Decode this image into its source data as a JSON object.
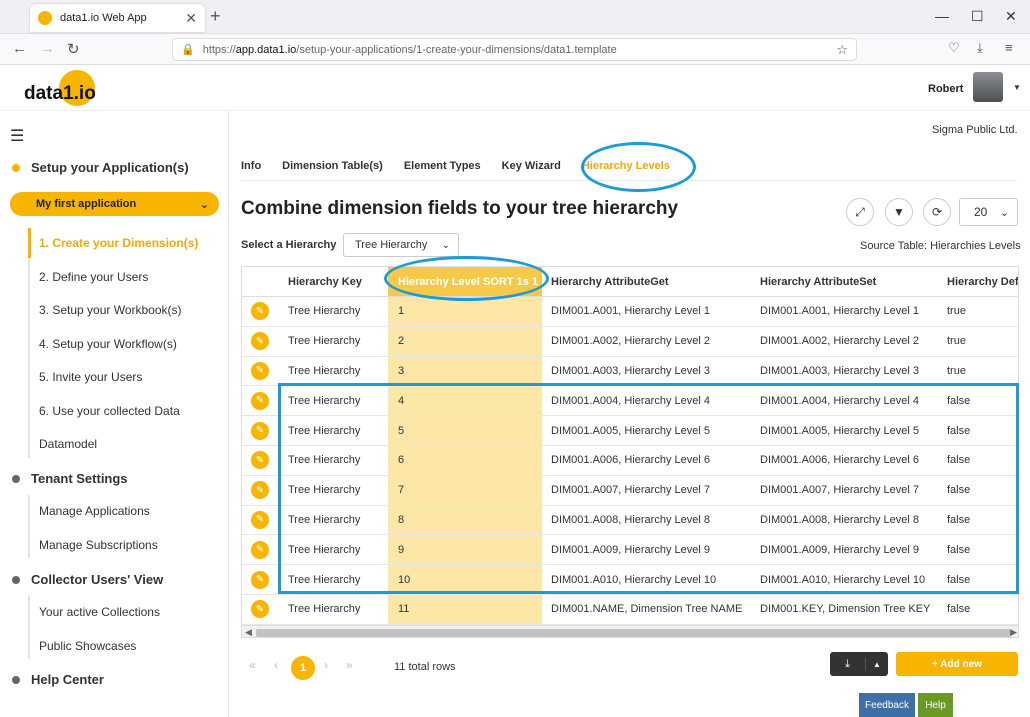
{
  "browser": {
    "tab_title": "data1.io Web App",
    "url_host": "app.data1.io",
    "url_prefix": "https://",
    "url_path": "/setup-your-applications/1-create-your-dimensions/data1.template"
  },
  "header": {
    "logo": "data1.io",
    "user_name": "Robert"
  },
  "sidebar": {
    "setup_title": "Setup your Application(s)",
    "app_selected": "My first application",
    "setup_items": [
      "1. Create your Dimension(s)",
      "2. Define your Users",
      "3. Setup your Workbook(s)",
      "4. Setup your Workflow(s)",
      "5. Invite your Users",
      "6. Use your collected Data",
      "Datamodel"
    ],
    "tenant_title": "Tenant Settings",
    "tenant_items": [
      "Manage Applications",
      "Manage Subscriptions"
    ],
    "collector_title": "Collector Users' View",
    "collector_items": [
      "Your active Collections",
      "Public Showcases"
    ],
    "help_title": "Help Center"
  },
  "main": {
    "company": "Sigma Public Ltd.",
    "tabs": [
      "Info",
      "Dimension Table(s)",
      "Element Types",
      "Key Wizard",
      "Hierarchy Levels"
    ],
    "active_tab": "Hierarchy Levels",
    "title": "Combine dimension fields to your tree hierarchy",
    "page_size": "20",
    "hierarchy_label": "Select a Hierarchy",
    "hierarchy_value": "Tree Hierarchy",
    "source_table": "Source Table: Hierarchies Levels"
  },
  "table": {
    "columns": [
      "Hierarchy Key",
      "Hierarchy Level SORT 1s 1",
      "Hierarchy AttributeGet",
      "Hierarchy AttributeSet",
      "Hierarchy Def"
    ],
    "rows": [
      [
        "Tree Hierarchy",
        "1",
        "DIM001.A001, Hierarchy Level 1",
        "DIM001.A001, Hierarchy Level 1",
        "true"
      ],
      [
        "Tree Hierarchy",
        "2",
        "DIM001.A002, Hierarchy Level 2",
        "DIM001.A002, Hierarchy Level 2",
        "true"
      ],
      [
        "Tree Hierarchy",
        "3",
        "DIM001.A003, Hierarchy Level 3",
        "DIM001.A003, Hierarchy Level 3",
        "true"
      ],
      [
        "Tree Hierarchy",
        "4",
        "DIM001.A004, Hierarchy Level 4",
        "DIM001.A004, Hierarchy Level 4",
        "false"
      ],
      [
        "Tree Hierarchy",
        "5",
        "DIM001.A005, Hierarchy Level 5",
        "DIM001.A005, Hierarchy Level 5",
        "false"
      ],
      [
        "Tree Hierarchy",
        "6",
        "DIM001.A006, Hierarchy Level 6",
        "DIM001.A006, Hierarchy Level 6",
        "false"
      ],
      [
        "Tree Hierarchy",
        "7",
        "DIM001.A007, Hierarchy Level 7",
        "DIM001.A007, Hierarchy Level 7",
        "false"
      ],
      [
        "Tree Hierarchy",
        "8",
        "DIM001.A008, Hierarchy Level 8",
        "DIM001.A008, Hierarchy Level 8",
        "false"
      ],
      [
        "Tree Hierarchy",
        "9",
        "DIM001.A009, Hierarchy Level 9",
        "DIM001.A009, Hierarchy Level 9",
        "false"
      ],
      [
        "Tree Hierarchy",
        "10",
        "DIM001.A010, Hierarchy Level 10",
        "DIM001.A010, Hierarchy Level 10",
        "false"
      ],
      [
        "Tree Hierarchy",
        "11",
        "DIM001.NAME, Dimension Tree NAME",
        "DIM001.KEY, Dimension Tree KEY",
        "false"
      ]
    ]
  },
  "footer": {
    "current_page": "1",
    "total_rows": "11 total rows",
    "add_new": "+ Add new",
    "feedback": "Feedback",
    "help": "Help"
  },
  "colors": {
    "accent": "#f7b500",
    "annotation": "#1b9bd7",
    "feedback": "#3e6fa6",
    "help": "#6a9a23"
  }
}
